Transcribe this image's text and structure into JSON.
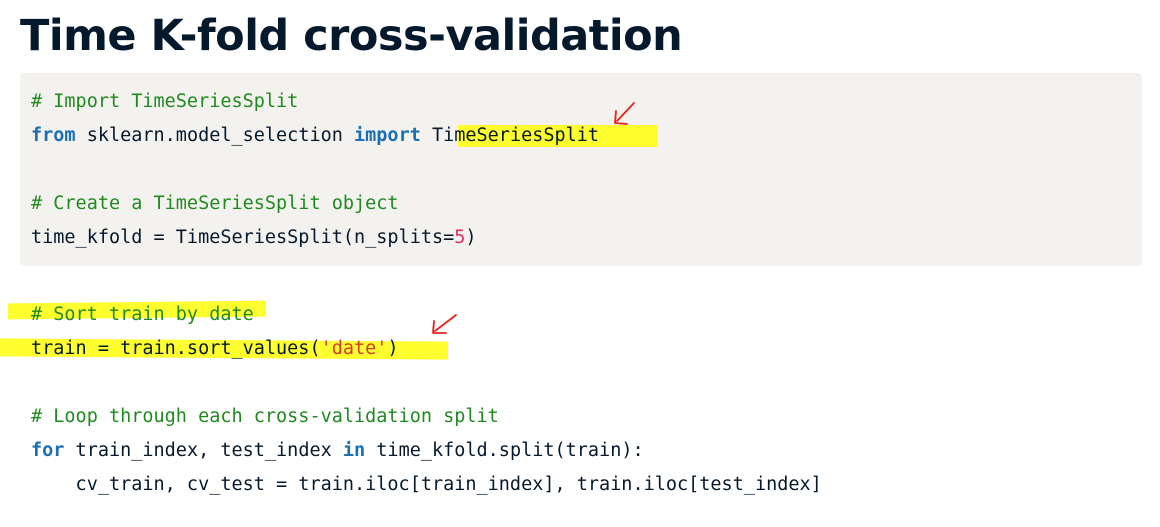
{
  "page_title": "Time K-fold cross-validation",
  "code_blocks": [
    {
      "lines": [
        [
          {
            "t": "comment",
            "v": "# Import TimeSeriesSplit"
          }
        ],
        [
          {
            "t": "keyword",
            "v": "from"
          },
          {
            "t": "plain",
            "v": " sklearn.model_selection "
          },
          {
            "t": "keyword",
            "v": "import"
          },
          {
            "t": "plain",
            "v": " TimeSeriesSplit"
          }
        ],
        [],
        [
          {
            "t": "comment",
            "v": "# Create a TimeSeriesSplit object"
          }
        ],
        [
          {
            "t": "plain",
            "v": "time_kfold = TimeSeriesSplit(n_splits="
          },
          {
            "t": "number",
            "v": "5"
          },
          {
            "t": "plain",
            "v": ")"
          }
        ]
      ]
    },
    {
      "lines": [
        [
          {
            "t": "comment",
            "v": "# Sort train by date"
          }
        ],
        [
          {
            "t": "plain",
            "v": "train = train.sort_values("
          },
          {
            "t": "string",
            "v": "'date'"
          },
          {
            "t": "plain",
            "v": ")"
          }
        ],
        [],
        [
          {
            "t": "comment",
            "v": "# Loop through each cross-validation split"
          }
        ],
        [
          {
            "t": "keyword",
            "v": "for"
          },
          {
            "t": "plain",
            "v": " train_index, test_index "
          },
          {
            "t": "keyword",
            "v": "in"
          },
          {
            "t": "plain",
            "v": " time_kfold.split(train):"
          }
        ],
        [
          {
            "t": "plain",
            "v": "    cv_train, cv_test = train.iloc[train_index], train.iloc[test_index]"
          }
        ]
      ]
    }
  ],
  "colors": {
    "title": "#05192d",
    "code_background": "#f4f2ee",
    "comment": "#1f8a1f",
    "keyword": "#1a6fb3",
    "number": "#d62f66",
    "string": "#d63a2b",
    "highlight": "#ffff1a",
    "annotation_arrow": "#e8221a"
  },
  "annotations": {
    "highlights": [
      "TimeSeriesSplit",
      "# Sort train by date",
      "train = train.sort_values('date')"
    ],
    "arrows": [
      "arrow-icon",
      "arrow-icon"
    ]
  }
}
